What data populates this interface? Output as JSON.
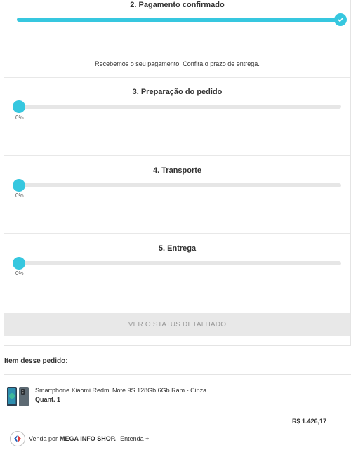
{
  "steps": [
    {
      "title": "2. Pagamento confirmado",
      "progress": 100,
      "message": "Recebemos o seu pagamento. Confira o prazo de entrega."
    },
    {
      "title": "3. Preparação do pedido",
      "progress": 0,
      "percent_label": "0%"
    },
    {
      "title": "4. Transporte",
      "progress": 0,
      "percent_label": "0%"
    },
    {
      "title": "5. Entrega",
      "progress": 0,
      "percent_label": "0%"
    }
  ],
  "status_button": {
    "label": "VER O STATUS DETALHADO"
  },
  "items_section": {
    "heading": "Item desse pedido:",
    "product": {
      "name": "Smartphone Xiaomi Redmi Note 9S 128Gb 6Gb Ram - Cinza",
      "quantity": "Quant. 1",
      "price": "R$ 1.426,17"
    },
    "seller": {
      "prefix": "Venda por",
      "name": "MEGA INFO SHOP.",
      "link": "Entenda +"
    }
  },
  "colors": {
    "accent": "#36c7df",
    "track": "#e6e6e6",
    "button_bg": "#e8e8e8"
  },
  "icons": {
    "done": "check-icon",
    "seller": "carrefour-logo"
  }
}
